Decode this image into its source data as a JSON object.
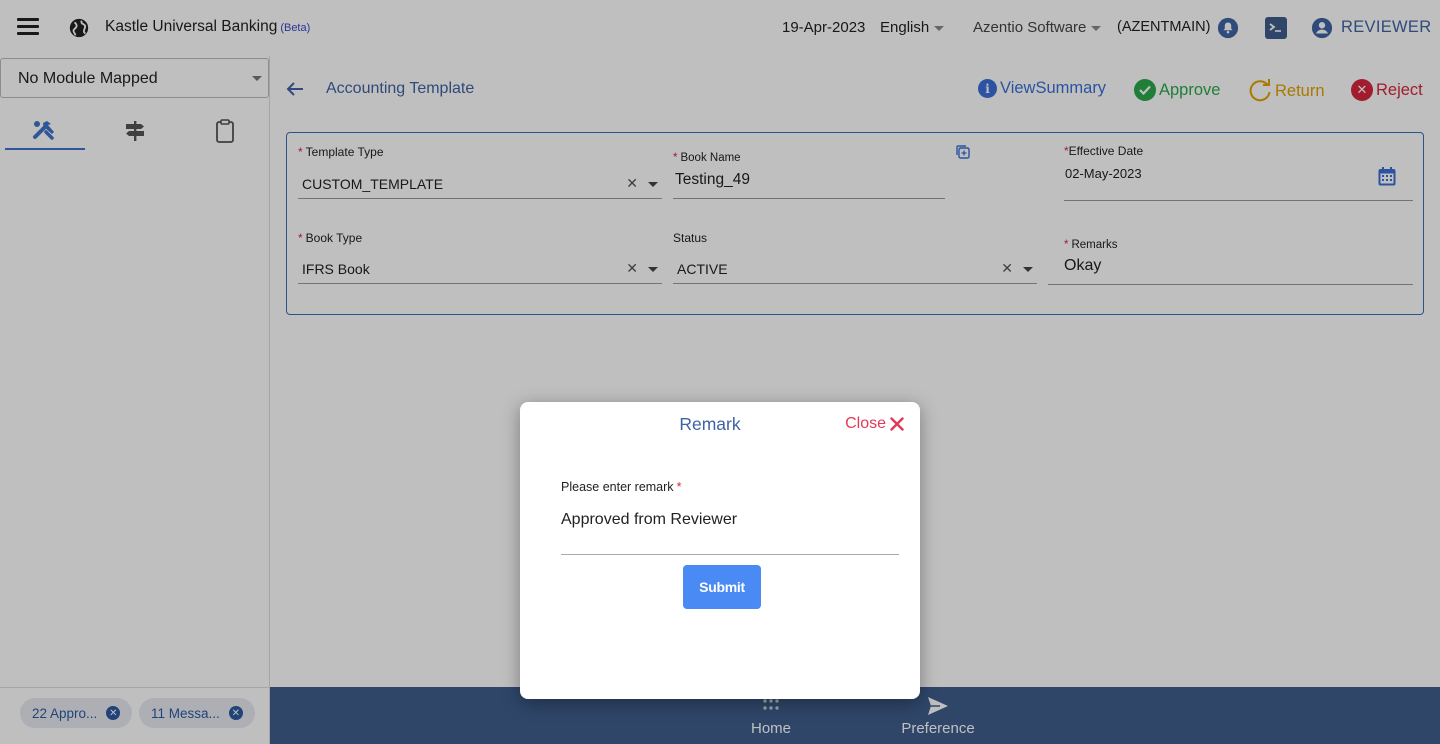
{
  "header": {
    "app_title": "Kastle Universal Banking",
    "beta": "(Beta)",
    "date": "19-Apr-2023",
    "language": "English",
    "company": "Azentio Software",
    "branch": "(AZENTMAIN)",
    "user": "REVIEWER"
  },
  "sidebar": {
    "module": "No Module Mapped",
    "chips": [
      "22 Appro...",
      "11 Messa..."
    ]
  },
  "main": {
    "title": "Accounting Template",
    "actions": {
      "view_summary": "ViewSummary",
      "approve": "Approve",
      "return": "Return",
      "reject": "Reject"
    }
  },
  "form": {
    "template_type": {
      "label": "Template Type",
      "value": "CUSTOM_TEMPLATE"
    },
    "book_name": {
      "label": "Book Name",
      "value": "Testing_49"
    },
    "effective_date": {
      "label": "Effective Date",
      "value": "02-May-2023"
    },
    "book_type": {
      "label": "Book Type",
      "value": "IFRS Book"
    },
    "status": {
      "label": "Status",
      "value": "ACTIVE"
    },
    "remarks": {
      "label": "Remarks",
      "value": "Okay"
    }
  },
  "modal": {
    "title": "Remark",
    "close": "Close",
    "field_label": "Please enter remark",
    "field_value": "Approved from Reviewer",
    "submit": "Submit"
  },
  "footer": {
    "home": "Home",
    "preference": "Preference"
  },
  "colors": {
    "primary": "#3f63a4",
    "approve": "#2aa84a",
    "return": "#e0a300",
    "reject": "#d8263e",
    "footer": "#3f5e8c",
    "submit": "#4a8af4"
  }
}
